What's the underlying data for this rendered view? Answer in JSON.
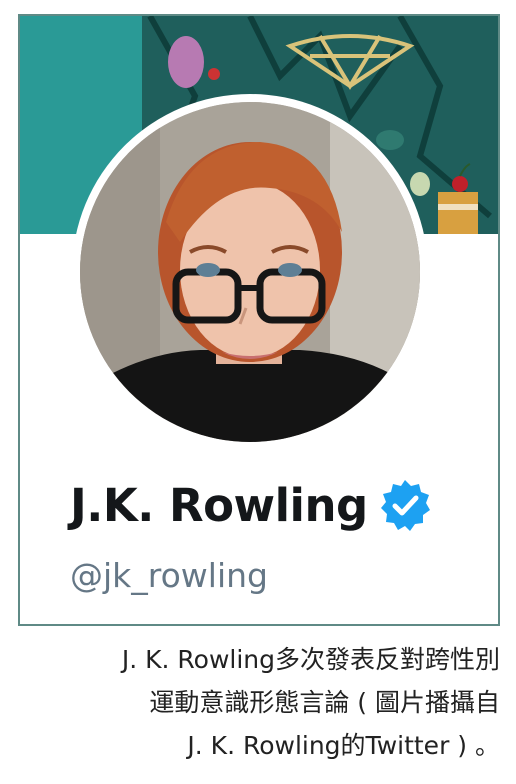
{
  "profile": {
    "display_name": "J.K. Rowling",
    "handle": "@jk_rowling"
  },
  "icons": {
    "verified": "verified-badge-icon"
  },
  "caption": {
    "line1": "J. K. Rowling多次發表反對跨性別",
    "line2": "運動意識形態言論 ( 圖片播攝自",
    "line3": "J. K. Rowling的Twitter ) 。"
  },
  "colors": {
    "banner": "#1f5f5c",
    "card_border": "#5f8a86",
    "verified": "#1da1f2",
    "name": "#14171a",
    "handle": "#657786"
  }
}
